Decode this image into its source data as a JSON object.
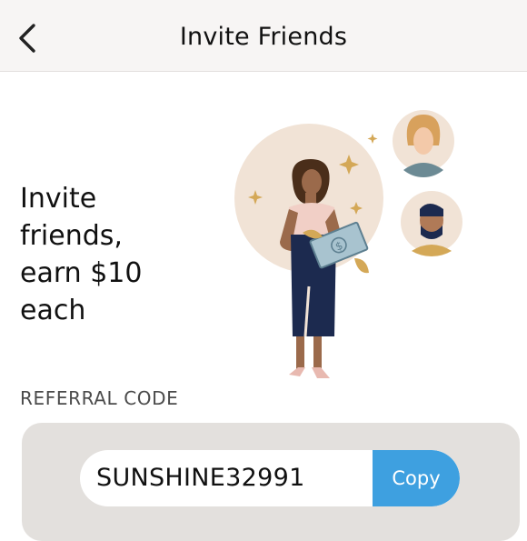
{
  "header": {
    "title": "Invite Friends",
    "back_icon": "chevron-left-icon"
  },
  "promo": {
    "line1": "Invite",
    "line2": "friends,",
    "line3": "earn $10",
    "line4": "each"
  },
  "referral": {
    "label": "REFERRAL CODE",
    "code": "SUNSHINE32991",
    "copy_label": "Copy"
  },
  "colors": {
    "accent": "#3ea0e0",
    "header_bg": "#f7f5f4",
    "panel_bg": "#e3e0dd"
  }
}
